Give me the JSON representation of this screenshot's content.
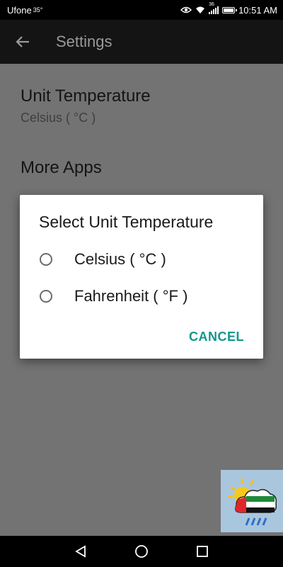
{
  "status_bar": {
    "carrier": "Ufone",
    "temperature": "35°",
    "network": "36",
    "time": "10:51 AM",
    "battery_level": 0.85
  },
  "app_bar": {
    "title": "Settings",
    "back_icon": "arrow-back-icon"
  },
  "preferences": [
    {
      "title": "Unit Temperature",
      "summary": "Celsius ( °C )"
    },
    {
      "title": "More Apps"
    }
  ],
  "dialog": {
    "title": "Select Unit Temperature",
    "options": [
      {
        "label": "Celsius ( °C )",
        "selected": false
      },
      {
        "label": "Fahrenheit ( °F )",
        "selected": false
      }
    ],
    "cancel_label": "CANCEL"
  },
  "colors": {
    "accent": "#13978b",
    "scrim_background": "#737373",
    "app_bar": "#141414"
  },
  "nav_bar": {
    "icons": [
      "nav-back-icon",
      "nav-home-icon",
      "nav-recents-icon"
    ]
  }
}
